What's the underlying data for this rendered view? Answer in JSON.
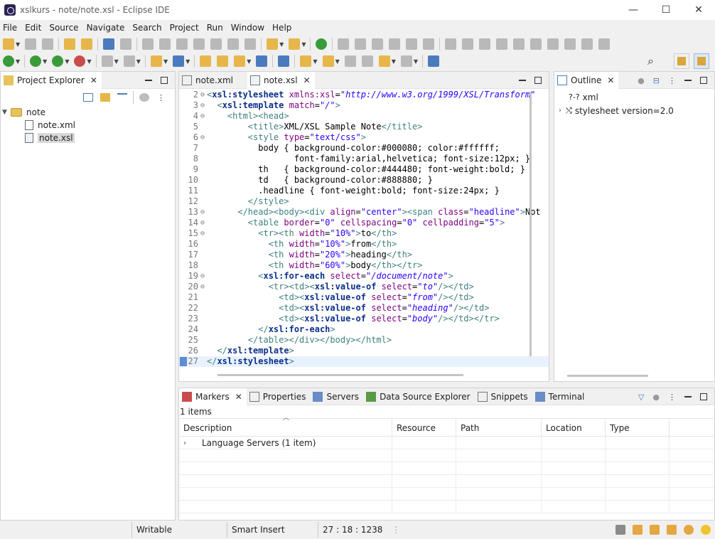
{
  "window": {
    "title": "xslkurs - note/note.xsl - Eclipse IDE",
    "controls": [
      "—",
      "☐",
      "✕"
    ]
  },
  "menu": [
    "File",
    "Edit",
    "Source",
    "Navigate",
    "Search",
    "Project",
    "Run",
    "Window",
    "Help"
  ],
  "project_explorer": {
    "title": "Project Explorer",
    "tree": [
      {
        "label": "note",
        "kind": "folder",
        "level": 0,
        "expanded": true
      },
      {
        "label": "note.xml",
        "kind": "file",
        "level": 1
      },
      {
        "label": "note.xsl",
        "kind": "file",
        "level": 1,
        "selected": true
      }
    ]
  },
  "editor": {
    "tabs": [
      {
        "label": "note.xml",
        "active": false
      },
      {
        "label": "note.xsl",
        "active": true
      }
    ],
    "lines": [
      {
        "n": "2",
        "fold": "⊖",
        "tokens": [
          [
            "tag",
            "<"
          ],
          [
            "x",
            "xsl:stylesheet"
          ],
          [
            "txt",
            " "
          ],
          [
            "attr",
            "xmlns:xsl"
          ],
          [
            "txt",
            "="
          ],
          [
            "val",
            "\"http://www.w3.org/1999/XSL/Transform\""
          ]
        ]
      },
      {
        "n": "3",
        "fold": "⊖",
        "tokens": [
          [
            "txt",
            "  "
          ],
          [
            "tag",
            "<"
          ],
          [
            "x",
            "xsl:template"
          ],
          [
            "txt",
            " "
          ],
          [
            "attr",
            "match"
          ],
          [
            "txt",
            "="
          ],
          [
            "val",
            "\"/\""
          ],
          [
            "tag",
            ">"
          ]
        ]
      },
      {
        "n": "4",
        "fold": "⊖",
        "tokens": [
          [
            "txt",
            "    "
          ],
          [
            "tag",
            "<html><head>"
          ]
        ]
      },
      {
        "n": "5",
        "fold": "",
        "tokens": [
          [
            "txt",
            "        "
          ],
          [
            "tag",
            "<title>"
          ],
          [
            "txt",
            "XML/XSL Sample Note"
          ],
          [
            "tag",
            "</title>"
          ]
        ]
      },
      {
        "n": "6",
        "fold": "⊖",
        "tokens": [
          [
            "txt",
            "        "
          ],
          [
            "tag",
            "<style "
          ],
          [
            "attr",
            "type"
          ],
          [
            "txt",
            "="
          ],
          [
            "str",
            "\"text/css\""
          ],
          [
            "tag",
            ">"
          ]
        ]
      },
      {
        "n": "7",
        "fold": "",
        "tokens": [
          [
            "txt",
            "          body { background-color:#000080; color:#ffffff;"
          ]
        ]
      },
      {
        "n": "8",
        "fold": "",
        "tokens": [
          [
            "txt",
            "                 font-family:arial,helvetica; font-size:12px; }"
          ]
        ]
      },
      {
        "n": "9",
        "fold": "",
        "tokens": [
          [
            "txt",
            "          th   { background-color:#444480; font-weight:bold; }"
          ]
        ]
      },
      {
        "n": "10",
        "fold": "",
        "tokens": [
          [
            "txt",
            "          td   { background-color:#888880; }"
          ]
        ]
      },
      {
        "n": "11",
        "fold": "",
        "tokens": [
          [
            "txt",
            "          .headline { font-weight:bold; font-size:24px; }"
          ]
        ]
      },
      {
        "n": "12",
        "fold": "",
        "tokens": [
          [
            "txt",
            "        "
          ],
          [
            "tag",
            "</style>"
          ]
        ]
      },
      {
        "n": "13",
        "fold": "⊖",
        "tokens": [
          [
            "txt",
            "      "
          ],
          [
            "tag",
            "</head><body><div "
          ],
          [
            "attr",
            "align"
          ],
          [
            "txt",
            "="
          ],
          [
            "str",
            "\"center\""
          ],
          [
            "tag",
            "><span "
          ],
          [
            "attr",
            "class"
          ],
          [
            "txt",
            "="
          ],
          [
            "str",
            "\"headline\""
          ],
          [
            "tag",
            ">"
          ],
          [
            "txt",
            "Not"
          ]
        ]
      },
      {
        "n": "14",
        "fold": "⊖",
        "tokens": [
          [
            "txt",
            "        "
          ],
          [
            "tag",
            "<table "
          ],
          [
            "attr",
            "border"
          ],
          [
            "txt",
            "="
          ],
          [
            "str",
            "\"0\""
          ],
          [
            "txt",
            " "
          ],
          [
            "attr",
            "cellspacing"
          ],
          [
            "txt",
            "="
          ],
          [
            "str",
            "\"0\""
          ],
          [
            "txt",
            " "
          ],
          [
            "attr",
            "cellpadding"
          ],
          [
            "txt",
            "="
          ],
          [
            "str",
            "\"5\""
          ],
          [
            "tag",
            ">"
          ]
        ]
      },
      {
        "n": "15",
        "fold": "⊖",
        "tokens": [
          [
            "txt",
            "          "
          ],
          [
            "tag",
            "<tr><th "
          ],
          [
            "attr",
            "width"
          ],
          [
            "txt",
            "="
          ],
          [
            "str",
            "\"10%\""
          ],
          [
            "tag",
            ">"
          ],
          [
            "txt",
            "to"
          ],
          [
            "tag",
            "</th>"
          ]
        ]
      },
      {
        "n": "16",
        "fold": "",
        "tokens": [
          [
            "txt",
            "            "
          ],
          [
            "tag",
            "<th "
          ],
          [
            "attr",
            "width"
          ],
          [
            "txt",
            "="
          ],
          [
            "str",
            "\"10%\""
          ],
          [
            "tag",
            ">"
          ],
          [
            "txt",
            "from"
          ],
          [
            "tag",
            "</th>"
          ]
        ]
      },
      {
        "n": "17",
        "fold": "",
        "tokens": [
          [
            "txt",
            "            "
          ],
          [
            "tag",
            "<th "
          ],
          [
            "attr",
            "width"
          ],
          [
            "txt",
            "="
          ],
          [
            "str",
            "\"20%\""
          ],
          [
            "tag",
            ">"
          ],
          [
            "txt",
            "heading"
          ],
          [
            "tag",
            "</th>"
          ]
        ]
      },
      {
        "n": "18",
        "fold": "",
        "tokens": [
          [
            "txt",
            "            "
          ],
          [
            "tag",
            "<th "
          ],
          [
            "attr",
            "width"
          ],
          [
            "txt",
            "="
          ],
          [
            "str",
            "\"60%\""
          ],
          [
            "tag",
            ">"
          ],
          [
            "txt",
            "body"
          ],
          [
            "tag",
            "</th></tr>"
          ]
        ]
      },
      {
        "n": "19",
        "fold": "⊖",
        "tokens": [
          [
            "txt",
            "          "
          ],
          [
            "tag",
            "<"
          ],
          [
            "x",
            "xsl:for-each"
          ],
          [
            "txt",
            " "
          ],
          [
            "attr",
            "select"
          ],
          [
            "txt",
            "="
          ],
          [
            "val",
            "\"/document/note\""
          ],
          [
            "tag",
            ">"
          ]
        ]
      },
      {
        "n": "20",
        "fold": "⊖",
        "tokens": [
          [
            "txt",
            "            "
          ],
          [
            "tag",
            "<tr><td><"
          ],
          [
            "x",
            "xsl:value-of"
          ],
          [
            "txt",
            " "
          ],
          [
            "attr",
            "select"
          ],
          [
            "txt",
            "="
          ],
          [
            "val",
            "\"to\""
          ],
          [
            "tag",
            "/></td>"
          ]
        ]
      },
      {
        "n": "21",
        "fold": "",
        "tokens": [
          [
            "txt",
            "              "
          ],
          [
            "tag",
            "<td><"
          ],
          [
            "x",
            "xsl:value-of"
          ],
          [
            "txt",
            " "
          ],
          [
            "attr",
            "select"
          ],
          [
            "txt",
            "="
          ],
          [
            "val",
            "\"from\""
          ],
          [
            "tag",
            "/></td>"
          ]
        ]
      },
      {
        "n": "22",
        "fold": "",
        "tokens": [
          [
            "txt",
            "              "
          ],
          [
            "tag",
            "<td><"
          ],
          [
            "x",
            "xsl:value-of"
          ],
          [
            "txt",
            " "
          ],
          [
            "attr",
            "select"
          ],
          [
            "txt",
            "="
          ],
          [
            "val",
            "\"heading\""
          ],
          [
            "tag",
            "/></td>"
          ]
        ]
      },
      {
        "n": "23",
        "fold": "",
        "tokens": [
          [
            "txt",
            "              "
          ],
          [
            "tag",
            "<td><"
          ],
          [
            "x",
            "xsl:value-of"
          ],
          [
            "txt",
            " "
          ],
          [
            "attr",
            "select"
          ],
          [
            "txt",
            "="
          ],
          [
            "val",
            "\"body\""
          ],
          [
            "tag",
            "/></td></tr>"
          ]
        ]
      },
      {
        "n": "24",
        "fold": "",
        "tokens": [
          [
            "txt",
            "          "
          ],
          [
            "tag",
            "</"
          ],
          [
            "x",
            "xsl:for-each"
          ],
          [
            "tag",
            ">"
          ]
        ]
      },
      {
        "n": "25",
        "fold": "",
        "tokens": [
          [
            "txt",
            "        "
          ],
          [
            "tag",
            "</table></div></body></html>"
          ]
        ]
      },
      {
        "n": "26",
        "fold": "",
        "tokens": [
          [
            "txt",
            "  "
          ],
          [
            "tag",
            "</"
          ],
          [
            "x",
            "xsl:template"
          ],
          [
            "tag",
            ">"
          ]
        ]
      },
      {
        "n": "27",
        "fold": "",
        "current": true,
        "tokens": [
          [
            "tag",
            "</"
          ],
          [
            "x",
            "xsl:stylesheet"
          ],
          [
            "tag",
            ">"
          ]
        ]
      }
    ]
  },
  "outline": {
    "title": "Outline",
    "items": [
      {
        "icon": "?-?",
        "label": "xml",
        "expandable": false
      },
      {
        "icon": "⤭",
        "label": "stylesheet version=2.0",
        "expandable": true
      }
    ]
  },
  "bottom_panel": {
    "tabs": [
      {
        "label": "Markers",
        "active": true
      },
      {
        "label": "Properties",
        "active": false
      },
      {
        "label": "Servers",
        "active": false
      },
      {
        "label": "Data Source Explorer",
        "active": false
      },
      {
        "label": "Snippets",
        "active": false
      },
      {
        "label": "Terminal",
        "active": false
      }
    ],
    "items_count": "1 items",
    "columns": [
      "Description",
      "Resource",
      "Path",
      "Location",
      "Type"
    ],
    "rows": [
      {
        "description": "Language Servers (1 item)",
        "resource": "",
        "path": "",
        "location": "",
        "type": ""
      }
    ]
  },
  "status_bar": {
    "writable": "Writable",
    "insert_mode": "Smart Insert",
    "position": "27 : 18 : 1238"
  },
  "colors": {
    "tag": "#3f7f7f",
    "xsl_element": "#0a2f8a",
    "attribute": "#7f007f",
    "value": "#2a00ff",
    "current_line": "#e8f2fe"
  }
}
